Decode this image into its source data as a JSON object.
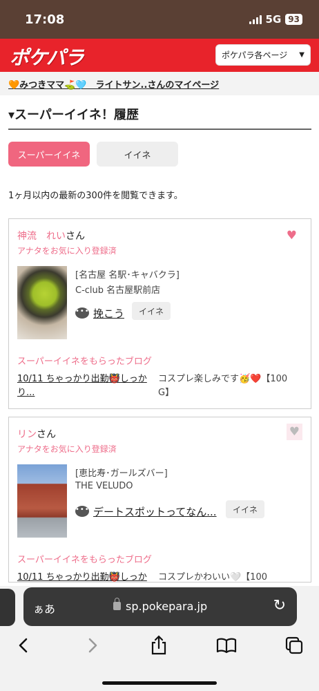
{
  "status": {
    "time": "17:08",
    "network": "5G",
    "battery": "93"
  },
  "header": {
    "logo": "ポケパラ",
    "menu_label": "ポケパラ各ページ",
    "menu_arrow": "▼"
  },
  "user_bar": {
    "text": "🧡みつきママ⛳️🩵　ライトサン..さんのマイページ"
  },
  "section": {
    "title": "▾スーパーイイネ！履歴"
  },
  "tabs": [
    {
      "label": "スーパーイイネ",
      "active": true
    },
    {
      "label": "イイネ",
      "active": false
    }
  ],
  "notice": "1ヶ月以内の最新の300件を閲覧できます。",
  "cards": [
    {
      "name": "神流　れい",
      "honorific": "さん",
      "fav": "アナタをお気に入り登録済",
      "heart": "♥",
      "category": "[名古屋 名駅･キャバクラ]",
      "shop": "C-club 名古屋駅前店",
      "chat_icon": "•••",
      "chat_text": "挽こう",
      "iine": "イイネ",
      "blog_label": "スーパーイイネをもらったブログ",
      "blog_line1": "10/11 ちゃっかり出勤👹しっか",
      "blog_line2": "り...",
      "comment_line1": "コスプレ楽しみです🥳❤️【100",
      "comment_line2": "G】"
    },
    {
      "name": "リン",
      "honorific": "さん",
      "fav": "アナタをお気に入り登録済",
      "heart": "♥",
      "category": "[恵比寿･ガールズバー]",
      "shop": "THE VELUDO",
      "chat_icon": "•••",
      "chat_text": "デートスポットってなん...",
      "iine": "イイネ",
      "blog_label": "スーパーイイネをもらったブログ",
      "blog_line1": "10/11 ちゃっかり出勤👹しっか",
      "comment_line1": "コスプレかわいい🤍【100"
    }
  ],
  "browser": {
    "aa": "ぁあ",
    "url": "sp.pokepara.jp",
    "reload": "↻",
    "toolbar": [
      "back-icon",
      "forward-icon",
      "share-icon",
      "bookmarks-icon",
      "tabs-icon"
    ]
  },
  "colors": {
    "brand_red": "#e8232b",
    "accent_pink": "#f0667f",
    "status_bar": "#5a4034"
  }
}
